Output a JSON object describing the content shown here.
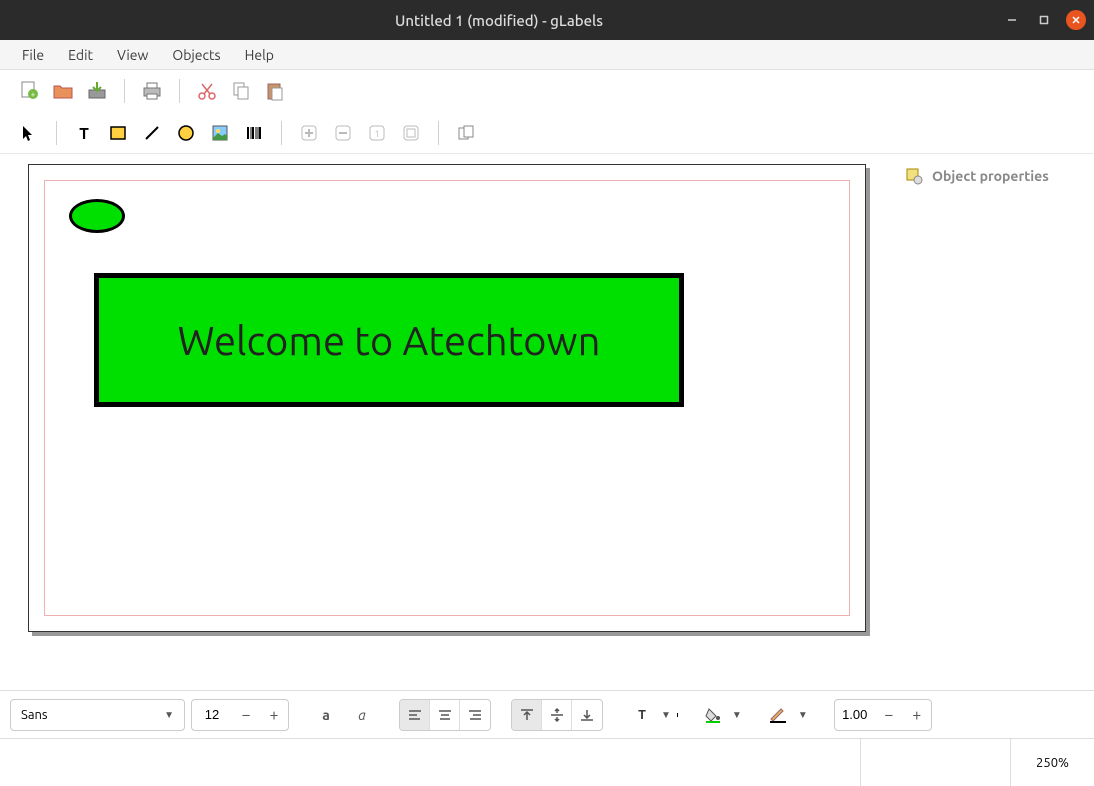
{
  "window": {
    "title": "Untitled 1 (modified) - gLabels"
  },
  "menubar": [
    "File",
    "Edit",
    "View",
    "Objects",
    "Help"
  ],
  "sidebar": {
    "properties_label": "Object properties"
  },
  "canvas": {
    "text": "Welcome to Atechtown",
    "ellipse_fill": "#00e000",
    "box_fill": "#00e000",
    "border_color": "#000000"
  },
  "format": {
    "font_family": "Sans",
    "font_size": "12",
    "line_width": "1.00",
    "text_color": "#000000",
    "fill_color": "#00c000",
    "line_color": "#000000"
  },
  "status": {
    "zoom": "250%"
  }
}
